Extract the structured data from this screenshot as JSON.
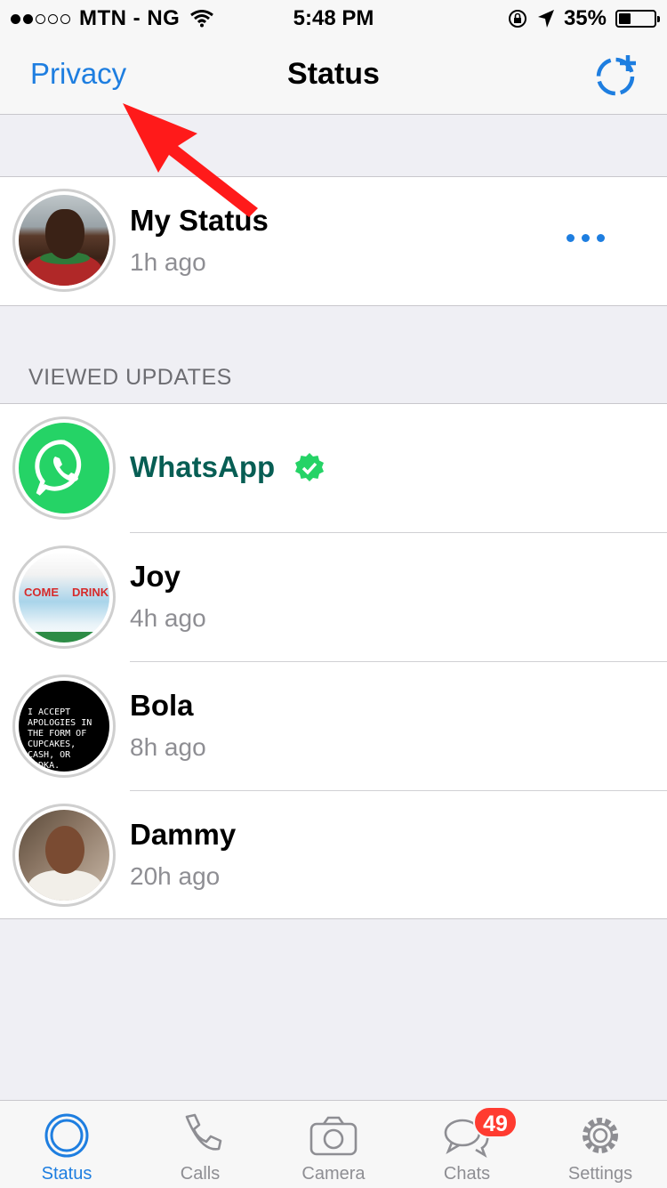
{
  "status_bar": {
    "carrier": "MTN - NG",
    "time": "5:48 PM",
    "battery": "35%",
    "battery_level": 0.35,
    "signal_bars": 2,
    "signal_total": 5
  },
  "navbar": {
    "left_label": "Privacy",
    "title": "Status",
    "add_icon": "new-status-icon"
  },
  "my_status": {
    "name": "My Status",
    "time": "1h ago",
    "more_icon": "more-dots-icon"
  },
  "viewed_header": "VIEWED UPDATES",
  "updates": [
    {
      "name": "WhatsApp",
      "time": "",
      "verified": true,
      "name_color": "#075e54"
    },
    {
      "name": "Joy",
      "time": "4h ago",
      "thumb_text_1": "COME",
      "thumb_text_2": "DRINK"
    },
    {
      "name": "Bola",
      "time": "8h ago",
      "thumb_text": "I ACCEPT APOLOGIES IN THE FORM OF CUPCAKES, CASH, OR VODKA."
    },
    {
      "name": "Dammy",
      "time": "20h ago"
    }
  ],
  "tabs": [
    {
      "label": "Status",
      "icon": "status-icon",
      "active": true
    },
    {
      "label": "Calls",
      "icon": "phone-icon"
    },
    {
      "label": "Camera",
      "icon": "camera-icon"
    },
    {
      "label": "Chats",
      "icon": "chat-bubbles-icon",
      "badge": "49"
    },
    {
      "label": "Settings",
      "icon": "gear-icon"
    }
  ],
  "colors": {
    "accent": "#1e7ee0",
    "whatsapp_green": "#25d366",
    "badge_red": "#ff3b30",
    "annotation_arrow": "#ff1a1a"
  }
}
